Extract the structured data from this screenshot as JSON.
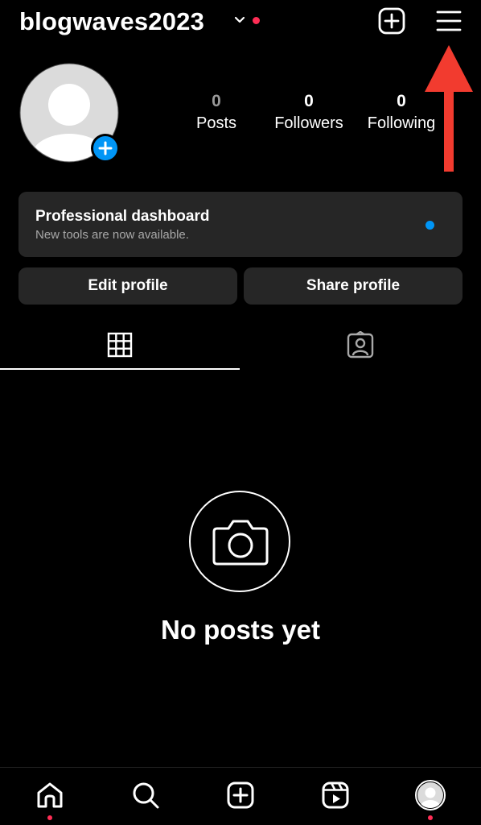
{
  "header": {
    "username": "blogwaves2023",
    "icons": [
      "chevron-down-icon",
      "notification-dot",
      "new-post-icon",
      "menu-icon"
    ]
  },
  "profile": {
    "stats": [
      {
        "value": "0",
        "label": "Posts"
      },
      {
        "value": "0",
        "label": "Followers"
      },
      {
        "value": "0",
        "label": "Following"
      }
    ]
  },
  "dashboard": {
    "title": "Professional dashboard",
    "subtitle": "New tools are now available."
  },
  "buttons": {
    "edit": "Edit profile",
    "share": "Share profile"
  },
  "tabs": [
    "grid-icon",
    "tagged-icon"
  ],
  "empty_state": {
    "text": "No posts yet"
  },
  "bottom_nav": [
    "home-icon",
    "search-icon",
    "create-icon",
    "reels-icon",
    "profile-icon"
  ],
  "colors": {
    "background": "#000000",
    "card": "#262626",
    "accent_blue": "#0095f6",
    "notification_red": "#ff2d55",
    "annotation_red": "#f23b2f"
  }
}
